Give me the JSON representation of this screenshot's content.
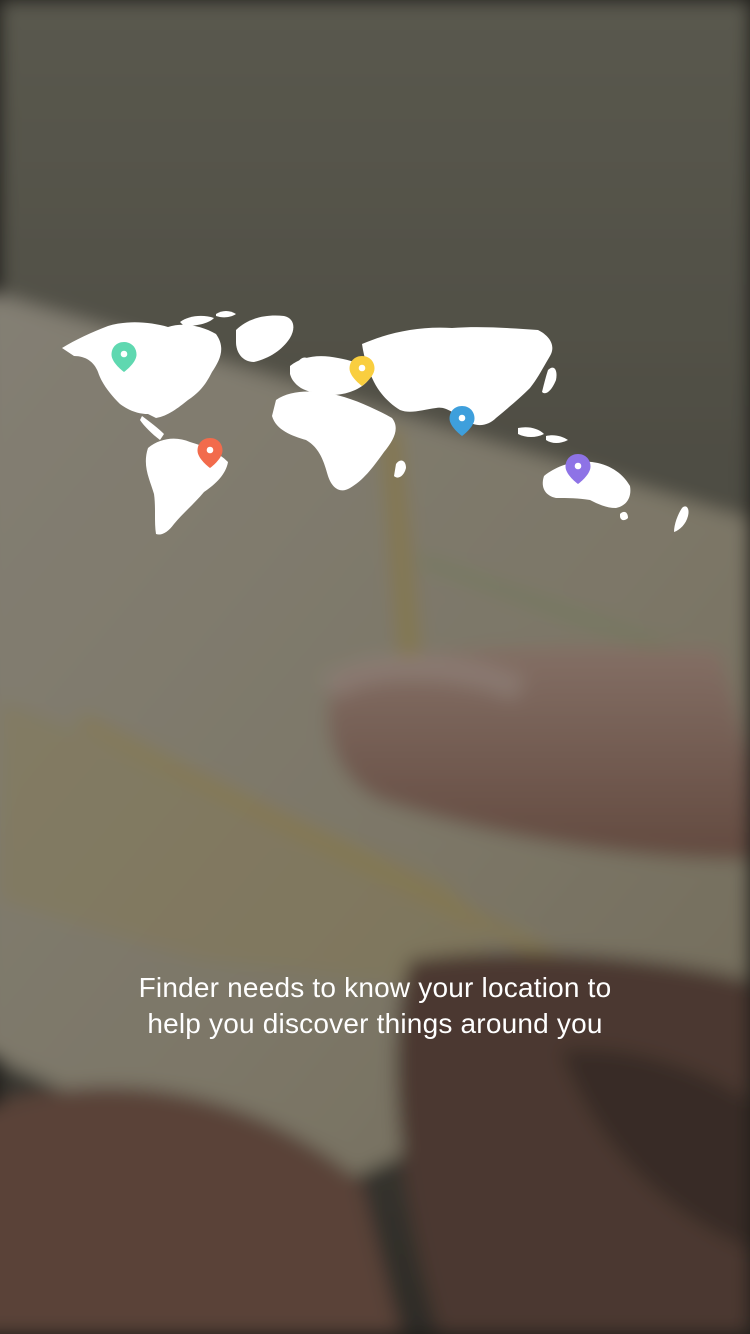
{
  "onboarding": {
    "message_line_1": "Finder needs to know your location to",
    "message_line_2": "help you discover things around you"
  },
  "icons": {
    "background": "map-in-hands-photo",
    "illustration": "world-map-icon",
    "pins": [
      "location-pin-icon",
      "location-pin-icon",
      "location-pin-icon",
      "location-pin-icon",
      "location-pin-icon"
    ]
  },
  "colors": {
    "text": "#ffffff",
    "continents": "#ffffff",
    "pin_north_america": "#5fd8b0",
    "pin_south_america": "#f26b4c",
    "pin_europe": "#f9ce3f",
    "pin_asia": "#3e9fdc",
    "pin_australia": "#8e73e6"
  }
}
